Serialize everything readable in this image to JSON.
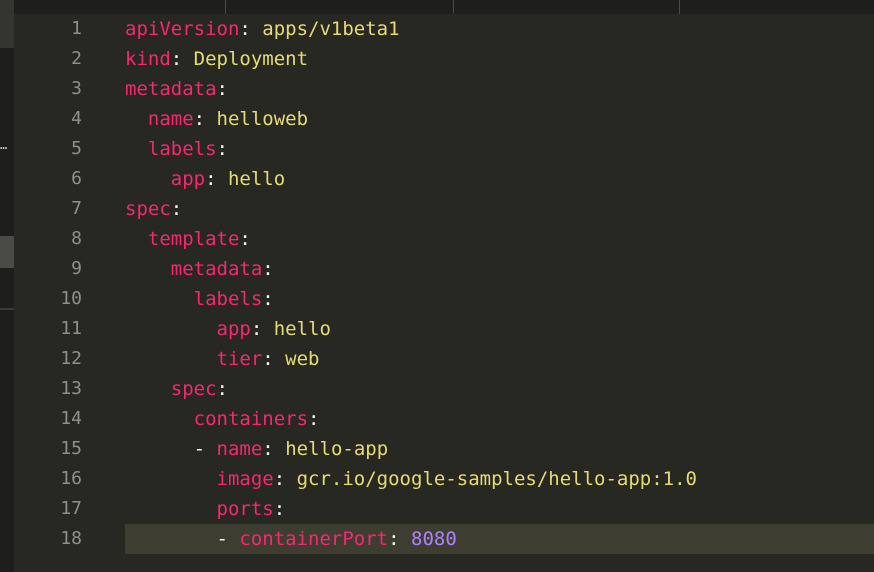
{
  "editor": {
    "colors": {
      "background": "#272822",
      "key": "#f92672",
      "string": "#e6db74",
      "number": "#ae81ff",
      "punct": "#f8f8f2",
      "line_number": "#90908a",
      "active_line": "#3e3d32"
    },
    "lines": [
      {
        "num": "1",
        "indent": "",
        "dash": "",
        "key": "apiVersion",
        "sep": ":",
        "value": " apps/v1beta1",
        "value_type": "string"
      },
      {
        "num": "2",
        "indent": "",
        "dash": "",
        "key": "kind",
        "sep": ":",
        "value": " Deployment",
        "value_type": "string"
      },
      {
        "num": "3",
        "indent": "",
        "dash": "",
        "key": "metadata",
        "sep": ":",
        "value": "",
        "value_type": "string"
      },
      {
        "num": "4",
        "indent": "  ",
        "dash": "",
        "key": "name",
        "sep": ":",
        "value": " helloweb",
        "value_type": "string"
      },
      {
        "num": "5",
        "indent": "  ",
        "dash": "",
        "key": "labels",
        "sep": ":",
        "value": "",
        "value_type": "string"
      },
      {
        "num": "6",
        "indent": "    ",
        "dash": "",
        "key": "app",
        "sep": ":",
        "value": " hello",
        "value_type": "string"
      },
      {
        "num": "7",
        "indent": "",
        "dash": "",
        "key": "spec",
        "sep": ":",
        "value": "",
        "value_type": "string"
      },
      {
        "num": "8",
        "indent": "  ",
        "dash": "",
        "key": "template",
        "sep": ":",
        "value": "",
        "value_type": "string"
      },
      {
        "num": "9",
        "indent": "    ",
        "dash": "",
        "key": "metadata",
        "sep": ":",
        "value": "",
        "value_type": "string"
      },
      {
        "num": "10",
        "indent": "      ",
        "dash": "",
        "key": "labels",
        "sep": ":",
        "value": "",
        "value_type": "string"
      },
      {
        "num": "11",
        "indent": "        ",
        "dash": "",
        "key": "app",
        "sep": ":",
        "value": " hello",
        "value_type": "string"
      },
      {
        "num": "12",
        "indent": "        ",
        "dash": "",
        "key": "tier",
        "sep": ":",
        "value": " web",
        "value_type": "string"
      },
      {
        "num": "13",
        "indent": "    ",
        "dash": "",
        "key": "spec",
        "sep": ":",
        "value": "",
        "value_type": "string"
      },
      {
        "num": "14",
        "indent": "      ",
        "dash": "",
        "key": "containers",
        "sep": ":",
        "value": "",
        "value_type": "string"
      },
      {
        "num": "15",
        "indent": "      ",
        "dash": "- ",
        "key": "name",
        "sep": ":",
        "value": " hello-app",
        "value_type": "string"
      },
      {
        "num": "16",
        "indent": "        ",
        "dash": "",
        "key": "image",
        "sep": ":",
        "value": " gcr.io/google-samples/hello-app:1.0",
        "value_type": "string"
      },
      {
        "num": "17",
        "indent": "        ",
        "dash": "",
        "key": "ports",
        "sep": ":",
        "value": "",
        "value_type": "string"
      },
      {
        "num": "18",
        "indent": "        ",
        "dash": "- ",
        "key": "containerPort",
        "sep": ":",
        "value": " 8080",
        "value_type": "number"
      }
    ],
    "active_line_number": 18
  },
  "sidebar": {
    "ellipsis_icon": "more-horizontal-icon",
    "ellipsis_text": "…"
  }
}
